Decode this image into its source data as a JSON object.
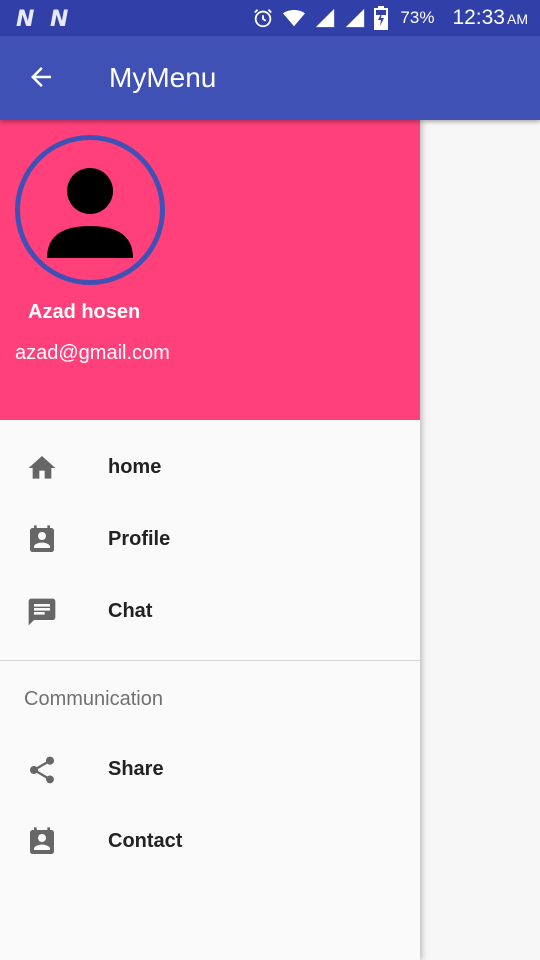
{
  "status_bar": {
    "left_icons": [
      "n-notification-icon",
      "n-notification-icon"
    ],
    "battery": "73%",
    "time": "12:33",
    "ampm": "AM"
  },
  "app_bar": {
    "title": "MyMenu"
  },
  "drawer": {
    "header": {
      "name": "Azad hosen",
      "email": "azad@gmail.com"
    },
    "items": [
      {
        "label": "home",
        "icon": "home-icon"
      },
      {
        "label": "Profile",
        "icon": "contact-card-icon"
      },
      {
        "label": "Chat",
        "icon": "chat-icon"
      }
    ],
    "section": {
      "title": "Communication",
      "items": [
        {
          "label": "Share",
          "icon": "share-icon"
        },
        {
          "label": "Contact",
          "icon": "contact-card-icon"
        }
      ]
    }
  },
  "colors": {
    "status_bar": "#3140a8",
    "app_bar": "#3f51b5",
    "header": "#ff407b",
    "drawer_bg": "#fafafa"
  }
}
